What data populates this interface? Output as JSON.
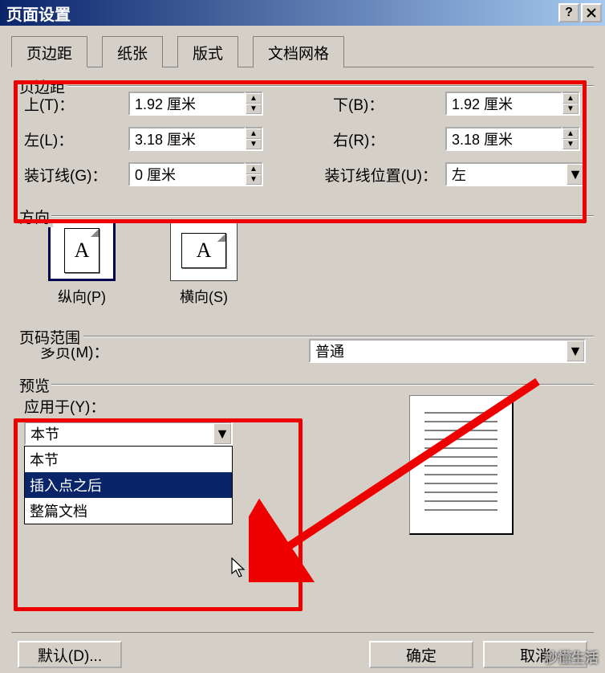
{
  "titlebar": {
    "title": "页面设置"
  },
  "tabs": {
    "margins": "页边距",
    "paper": "纸张",
    "layout": "版式",
    "grid": "文档网格"
  },
  "margins": {
    "legend": "页边距",
    "top_label": "上(T)：",
    "top_value": "1.92 厘米",
    "bottom_label": "下(B)：",
    "bottom_value": "1.92 厘米",
    "left_label": "左(L)：",
    "left_value": "3.18 厘米",
    "right_label": "右(R)：",
    "right_value": "3.18 厘米",
    "gutter_label": "装订线(G)：",
    "gutter_value": "0 厘米",
    "gutter_pos_label": "装订线位置(U)：",
    "gutter_pos_value": "左"
  },
  "orientation": {
    "legend": "方向",
    "portrait": "纵向(P)",
    "landscape": "横向(S)"
  },
  "pagerange": {
    "legend": "页码范围",
    "multipage_label": "多页(M)：",
    "multipage_value": "普通"
  },
  "preview": {
    "legend": "预览",
    "apply_label": "应用于(Y)：",
    "apply_value": "本节",
    "apply_options": {
      "o1": "本节",
      "o2": "插入点之后",
      "o3": "整篇文档"
    }
  },
  "buttons": {
    "default": "默认(D)...",
    "ok": "确定",
    "cancel": "取消"
  },
  "watermark": "秒懂生活"
}
